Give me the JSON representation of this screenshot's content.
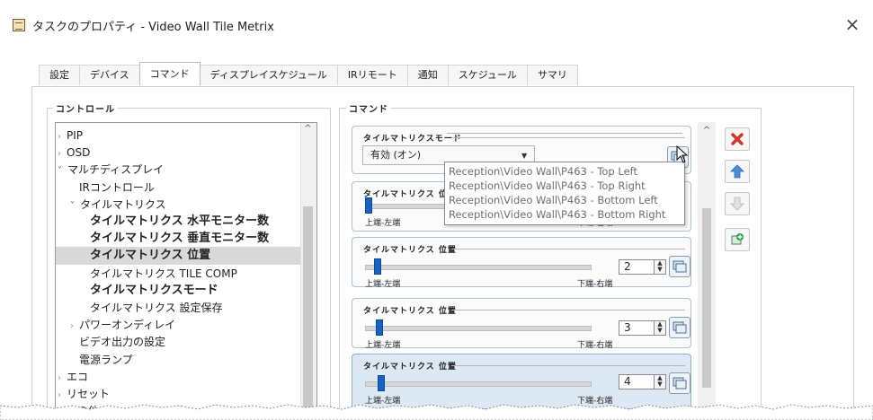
{
  "window": {
    "title": "タスクのプロパティ - Video Wall Tile Metrix",
    "close_glyph": "×"
  },
  "tabs": [
    {
      "label": "設定",
      "active": false
    },
    {
      "label": "デバイス",
      "active": false
    },
    {
      "label": "コマンド",
      "active": true
    },
    {
      "label": "ディスプレイスケジュール",
      "active": false
    },
    {
      "label": "IRリモート",
      "active": false
    },
    {
      "label": "通知",
      "active": false
    },
    {
      "label": "スケジュール",
      "active": false
    },
    {
      "label": "サマリ",
      "active": false
    }
  ],
  "control_group": {
    "label": "コントロール",
    "tree": [
      {
        "label": "PIP",
        "indent": 0,
        "expander": "collapsed",
        "bold": false,
        "selected": false
      },
      {
        "label": "OSD",
        "indent": 0,
        "expander": "collapsed",
        "bold": false,
        "selected": false
      },
      {
        "label": "マルチディスプレイ",
        "indent": 0,
        "expander": "expanded",
        "bold": false,
        "selected": false
      },
      {
        "label": "IRコントロール",
        "indent": 1,
        "expander": "none",
        "bold": false,
        "selected": false
      },
      {
        "label": "タイルマトリクス",
        "indent": 1,
        "expander": "expanded",
        "bold": false,
        "selected": false
      },
      {
        "label": "タイルマトリクス 水平モニター数",
        "indent": 2,
        "expander": "none",
        "bold": true,
        "selected": false
      },
      {
        "label": "タイルマトリクス 垂直モニター数",
        "indent": 2,
        "expander": "none",
        "bold": true,
        "selected": false
      },
      {
        "label": "タイルマトリクス 位置",
        "indent": 2,
        "expander": "none",
        "bold": true,
        "selected": true
      },
      {
        "label": "タイルマトリクス TILE COMP",
        "indent": 2,
        "expander": "none",
        "bold": false,
        "selected": false
      },
      {
        "label": "タイルマトリクスモード",
        "indent": 2,
        "expander": "none",
        "bold": true,
        "selected": false
      },
      {
        "label": "タイルマトリクス 設定保存",
        "indent": 2,
        "expander": "none",
        "bold": false,
        "selected": false
      },
      {
        "label": "パワーオンディレイ",
        "indent": 1,
        "expander": "collapsed",
        "bold": false,
        "selected": false
      },
      {
        "label": "ビデオ出力の設定",
        "indent": 1,
        "expander": "none",
        "bold": false,
        "selected": false
      },
      {
        "label": "電源ランプ",
        "indent": 1,
        "expander": "none",
        "bold": false,
        "selected": false
      },
      {
        "label": "エコ",
        "indent": 0,
        "expander": "collapsed",
        "bold": false,
        "selected": false
      },
      {
        "label": "リセット",
        "indent": 0,
        "expander": "collapsed",
        "bold": false,
        "selected": false
      },
      {
        "label": "その他",
        "indent": 0,
        "expander": "collapsed",
        "bold": false,
        "selected": false
      }
    ]
  },
  "command_group": {
    "label": "コマンド",
    "mode_card": {
      "title": "タイルマトリクスモード",
      "select_value": "有効 (オン)"
    },
    "position_cards": [
      {
        "title": "タイルマトリクス 位置",
        "min_label": "上端-左端",
        "max_label": "下端-右端",
        "value": "1",
        "selected": false
      },
      {
        "title": "タイルマトリクス 位置",
        "min_label": "上端-左端",
        "max_label": "下端-右端",
        "value": "2",
        "selected": false
      },
      {
        "title": "タイルマトリクス 位置",
        "min_label": "上端-左端",
        "max_label": "下端-右端",
        "value": "3",
        "selected": false
      },
      {
        "title": "タイルマトリクス 位置",
        "min_label": "上端-左端",
        "max_label": "下端-右端",
        "value": "4",
        "selected": true
      }
    ],
    "tooltip_lines": [
      "Reception\\Video Wall\\P463 - Top Left",
      "Reception\\Video Wall\\P463 - Top Right",
      "Reception\\Video Wall\\P463 - Bottom Left",
      "Reception\\Video Wall\\P463 - Bottom Right"
    ]
  },
  "action_buttons": [
    {
      "name": "delete-button",
      "icon": "red-x-icon"
    },
    {
      "name": "move-up-button",
      "icon": "arrow-up-icon"
    },
    {
      "name": "move-down-button",
      "icon": "arrow-down-icon"
    },
    {
      "name": "add-command-button",
      "icon": "add-icon"
    }
  ],
  "colors": {
    "accent_blue": "#1565c0",
    "selected_card": "#dce8f3",
    "delete_red": "#d9342b",
    "arrow_blue": "#4a90d9",
    "add_green": "#2e9e4a"
  }
}
